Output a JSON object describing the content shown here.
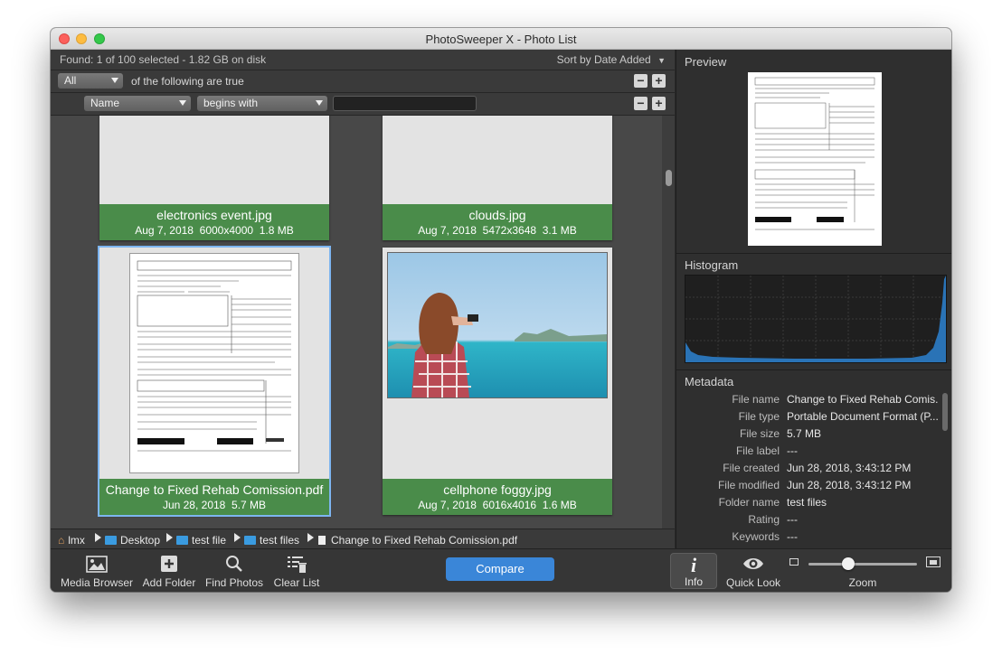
{
  "window": {
    "title": "PhotoSweeper X - Photo List"
  },
  "status": {
    "found": "Found: 1 of 100 selected - 1.82 GB on disk",
    "sort": "Sort by Date Added"
  },
  "filter": {
    "match": "All",
    "match_text": "of the following are true",
    "field": "Name",
    "operator": "begins with",
    "value": "",
    "minus": "−",
    "plus": "+"
  },
  "photos": [
    {
      "name": "electronics event.jpg",
      "date": "Aug 7, 2018",
      "dims": "6000x4000",
      "size": "1.8 MB"
    },
    {
      "name": "clouds.jpg",
      "date": "Aug 7, 2018",
      "dims": "5472x3648",
      "size": "3.1 MB"
    },
    {
      "name": "Change to Fixed Rehab Comission.pdf",
      "date": "Jun 28, 2018",
      "dims": "",
      "size": "5.7 MB"
    },
    {
      "name": "cellphone foggy.jpg",
      "date": "Aug 7, 2018",
      "dims": "6016x4016",
      "size": "1.6 MB"
    }
  ],
  "path": [
    {
      "label": "lmx",
      "icon": "home-icon"
    },
    {
      "label": "Desktop",
      "icon": "folder-icon"
    },
    {
      "label": "test file",
      "icon": "folder-icon"
    },
    {
      "label": "test files",
      "icon": "folder-icon"
    },
    {
      "label": "Change to Fixed Rehab Comission.pdf",
      "icon": "document-icon"
    }
  ],
  "panels": {
    "preview": "Preview",
    "histogram": "Histogram",
    "metadata": "Metadata"
  },
  "metadata": [
    {
      "key": "File name",
      "value": "Change to Fixed Rehab Comis..."
    },
    {
      "key": "File type",
      "value": "Portable Document Format (P..."
    },
    {
      "key": "File size",
      "value": "5.7 MB"
    },
    {
      "key": "File label",
      "value": "---"
    },
    {
      "key": "File created",
      "value": "Jun 28, 2018, 3:43:12 PM"
    },
    {
      "key": "File modified",
      "value": "Jun 28, 2018, 3:43:12 PM"
    },
    {
      "key": "Folder name",
      "value": "test files"
    },
    {
      "key": "Rating",
      "value": "---"
    },
    {
      "key": "Keywords",
      "value": "---"
    }
  ],
  "toolbar": {
    "media_browser": "Media Browser",
    "add_folder": "Add Folder",
    "find_photos": "Find Photos",
    "clear_list": "Clear List",
    "compare": "Compare",
    "info": "Info",
    "quick_look": "Quick Look",
    "zoom": "Zoom"
  },
  "zoom_level": 0.37,
  "colors": {
    "accent": "#3a86d8",
    "caption_green": "#4a8c4a",
    "folder_blue": "#3a9be0",
    "selection": "#7db5f0"
  }
}
